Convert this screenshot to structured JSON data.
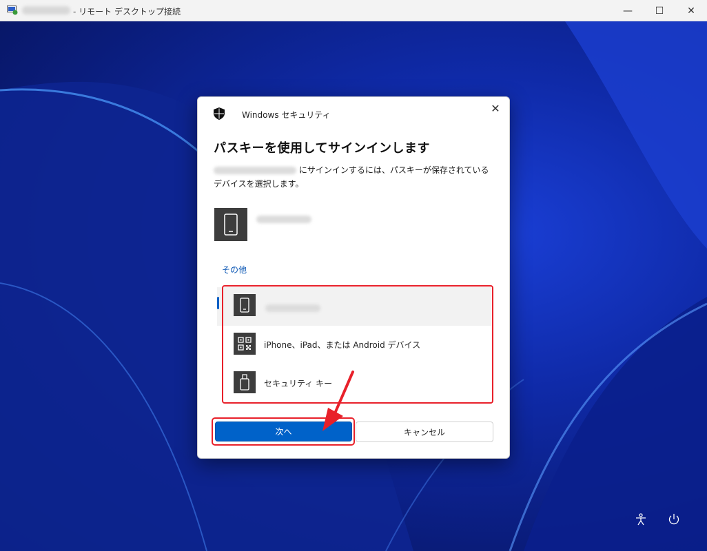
{
  "window": {
    "title": "- リモート デスクトップ接続",
    "minimize_glyph": "—",
    "maximize_glyph": "☐",
    "close_glyph": "✕"
  },
  "dialog": {
    "app_title": "Windows セキュリティ",
    "close_glyph": "✕",
    "heading": "パスキーを使用してサインインします",
    "description_suffix": "にサインインするには、パスキーが保存されているデバイスを選択します。",
    "other_label": "その他",
    "options": [
      {
        "icon": "phone-icon",
        "label": ""
      },
      {
        "icon": "qr-code-icon",
        "label": "iPhone、iPad、または Android デバイス"
      },
      {
        "icon": "usb-key-icon",
        "label": "セキュリティ キー"
      }
    ],
    "next_label": "次へ",
    "cancel_label": "キャンセル"
  },
  "colors": {
    "accent": "#0062c9",
    "highlight": "#e8202a",
    "desktop": "#0f2aa8"
  }
}
